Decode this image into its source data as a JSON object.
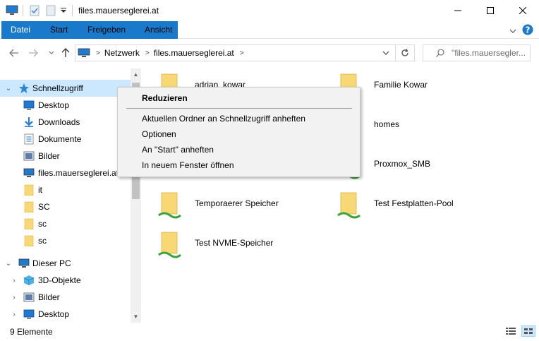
{
  "window": {
    "title": "files.mauerseglerei.at",
    "minimize_icon": "minimize-icon",
    "maximize_icon": "maximize-icon",
    "close_icon": "close-icon"
  },
  "ribbon": {
    "tabs": [
      {
        "label": "Datei"
      },
      {
        "label": "Start"
      },
      {
        "label": "Freigeben"
      },
      {
        "label": "Ansicht"
      }
    ]
  },
  "address": {
    "crumbs": [
      "Netzwerk",
      "files.mauerseglerei.at"
    ]
  },
  "search": {
    "placeholder": "\"files.mauersegler..."
  },
  "nav": {
    "items": [
      {
        "label": "Schnellzugriff"
      },
      {
        "label": "Desktop"
      },
      {
        "label": "Downloads"
      },
      {
        "label": "Dokumente"
      },
      {
        "label": "Bilder"
      },
      {
        "label": "files.mauerseglerei.at"
      },
      {
        "label": "it"
      },
      {
        "label": "SC"
      },
      {
        "label": "sc"
      },
      {
        "label": "sc"
      },
      {
        "label": "Dieser PC"
      },
      {
        "label": "3D-Objekte"
      },
      {
        "label": "Bilder"
      },
      {
        "label": "Desktop"
      }
    ]
  },
  "files": [
    {
      "name": "adrian_kowar"
    },
    {
      "name": "Familie Kowar"
    },
    {
      "name": "homes"
    },
    {
      "name": "Proxmox_SMB"
    },
    {
      "name": "Temporaerer Speicher"
    },
    {
      "name": "Test Festplatten-Pool"
    },
    {
      "name": "Test NVME-Speicher"
    }
  ],
  "context_menu": {
    "items": [
      {
        "label": "Reduzieren"
      },
      {
        "label": "Aktuellen Ordner an Schnellzugriff anheften"
      },
      {
        "label": "Optionen"
      },
      {
        "label": "An \"Start\" anheften"
      },
      {
        "label": "In neuem Fenster öffnen"
      }
    ]
  },
  "status": {
    "count": "9 Elemente"
  },
  "colors": {
    "accent": "#1979ca",
    "selection": "#cce8ff",
    "folder": "#f8d775",
    "share_pipe": "#3aa33a"
  }
}
